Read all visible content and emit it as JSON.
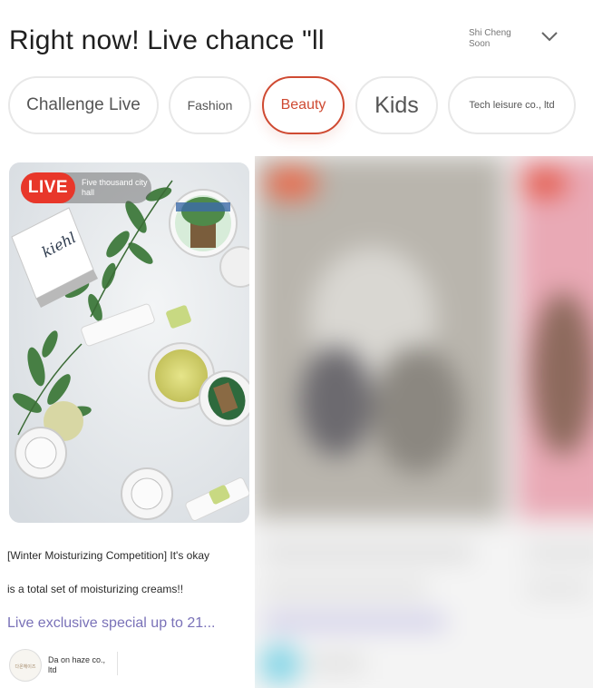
{
  "header": {
    "title": "Right now! Live chance \"ll",
    "channel_line1": "Shi Cheng",
    "channel_line2": "Soon",
    "chevron_icon": "chevron-down-icon"
  },
  "tabs": [
    {
      "label": "Challenge Live",
      "active": false
    },
    {
      "label": "Fashion",
      "active": false
    },
    {
      "label": "Beauty",
      "active": true
    },
    {
      "label": "Kids",
      "active": false
    },
    {
      "label": "Tech leisure co., ltd",
      "active": false
    }
  ],
  "featured": {
    "live_label": "LIVE",
    "viewers_text": "Five thousand city hall",
    "description_line1": "[Winter Moisturizing Competition] It's okay",
    "description_line2": "is a total set of moisturizing creams!!",
    "promo": "Live exclusive special up to 21...",
    "seller_name": "Da on haze co., ltd",
    "product_brand": "kiehl",
    "avatar_text": "다온헤이즈"
  },
  "colors": {
    "accent": "#cf4a32",
    "live_red": "#e8372a",
    "promo": "#7a72b8",
    "tab_border": "#e8e8e8"
  }
}
